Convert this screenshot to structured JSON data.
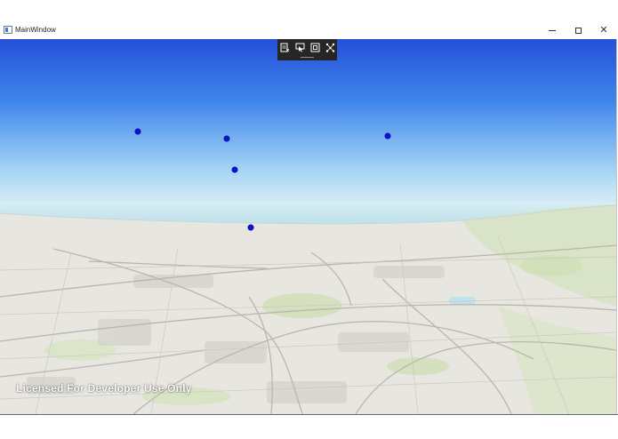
{
  "window": {
    "title": "MainWindow",
    "controls": {
      "minimize": "–",
      "maximize": "☐",
      "close": "✕"
    }
  },
  "toolbar": {
    "buttons": [
      "layer-list-icon",
      "select-arrow-icon",
      "frame-icon",
      "network-icon"
    ]
  },
  "scene": {
    "sky_colors": {
      "top": "#2451d6",
      "horizon": "#e6f1f6"
    },
    "water_color": "#bfe0ea",
    "point_color": "#0a14d8",
    "point_count": 5,
    "license_text": "Licensed For Developer Use Only"
  }
}
